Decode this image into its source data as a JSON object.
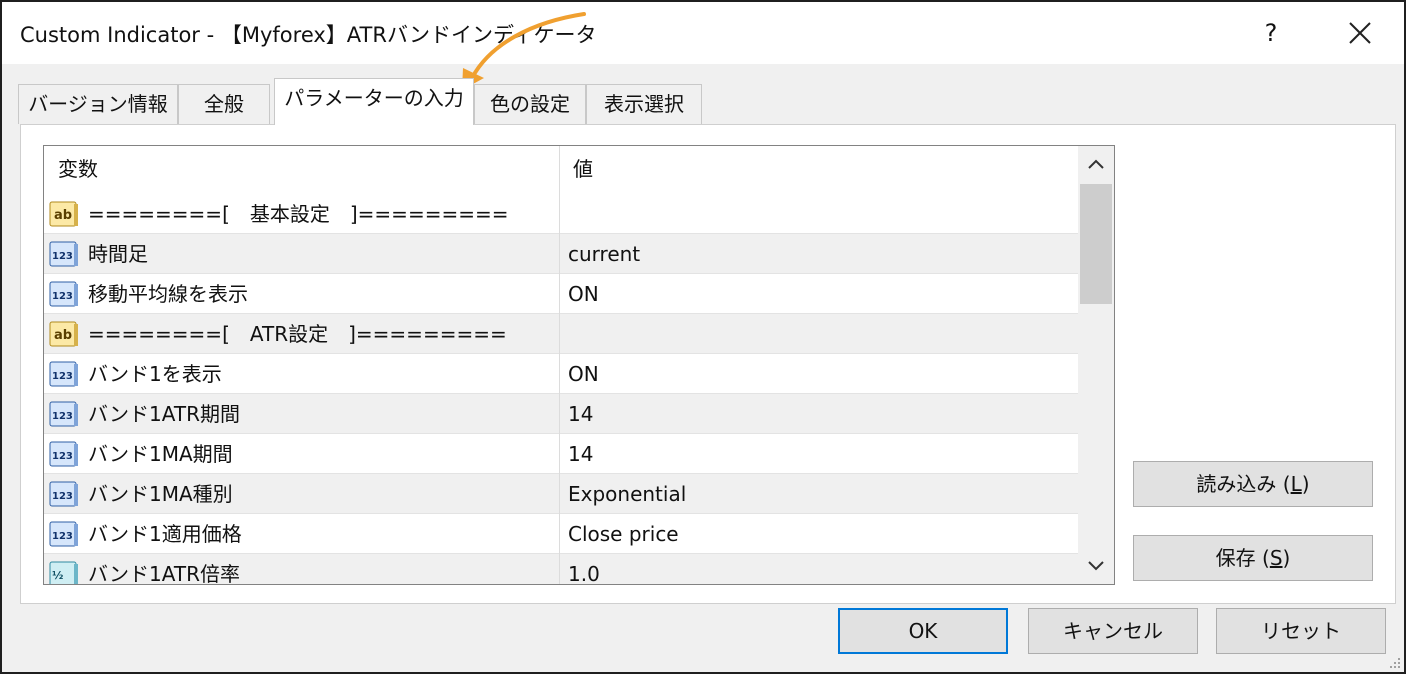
{
  "window": {
    "title": "Custom Indicator - 【Myforex】ATRバンドインディケータ",
    "help_label": "?"
  },
  "tabs": [
    {
      "label": "バージョン情報",
      "active": false
    },
    {
      "label": "全般",
      "active": false
    },
    {
      "label": "パラメーターの入力",
      "active": true
    },
    {
      "label": "色の設定",
      "active": false
    },
    {
      "label": "表示選択",
      "active": false
    }
  ],
  "grid": {
    "headers": {
      "name": "変数",
      "value": "値"
    },
    "rows": [
      {
        "icon": "ab-string-icon",
        "name": "========[　基本設定　]=========",
        "value": ""
      },
      {
        "icon": "123-integer-icon",
        "name": "時間足",
        "value": "current"
      },
      {
        "icon": "123-integer-icon",
        "name": "移動平均線を表示",
        "value": "ON"
      },
      {
        "icon": "ab-string-icon",
        "name": "========[　ATR設定　]=========",
        "value": ""
      },
      {
        "icon": "123-integer-icon",
        "name": "バンド1を表示",
        "value": "ON"
      },
      {
        "icon": "123-integer-icon",
        "name": "バンド1ATR期間",
        "value": "14"
      },
      {
        "icon": "123-integer-icon",
        "name": "バンド1MA期間",
        "value": "14"
      },
      {
        "icon": "123-integer-icon",
        "name": "バンド1MA種別",
        "value": "Exponential"
      },
      {
        "icon": "123-integer-icon",
        "name": "バンド1適用価格",
        "value": "Close price"
      },
      {
        "icon": "half-double-icon",
        "name": "バンド1ATR倍率",
        "value": "1.0"
      }
    ]
  },
  "side_buttons": {
    "load_label": "読み込み (",
    "load_key": "L",
    "save_label": "保存 (",
    "save_key": "S",
    "close_paren": ")"
  },
  "footer": {
    "ok_label": "OK",
    "cancel_label": "キャンセル",
    "reset_label": "リセット"
  },
  "colors": {
    "accent_arrow": "#f0a030",
    "default_button_border": "#0078d7",
    "row_alt": "#f0f0f0"
  }
}
